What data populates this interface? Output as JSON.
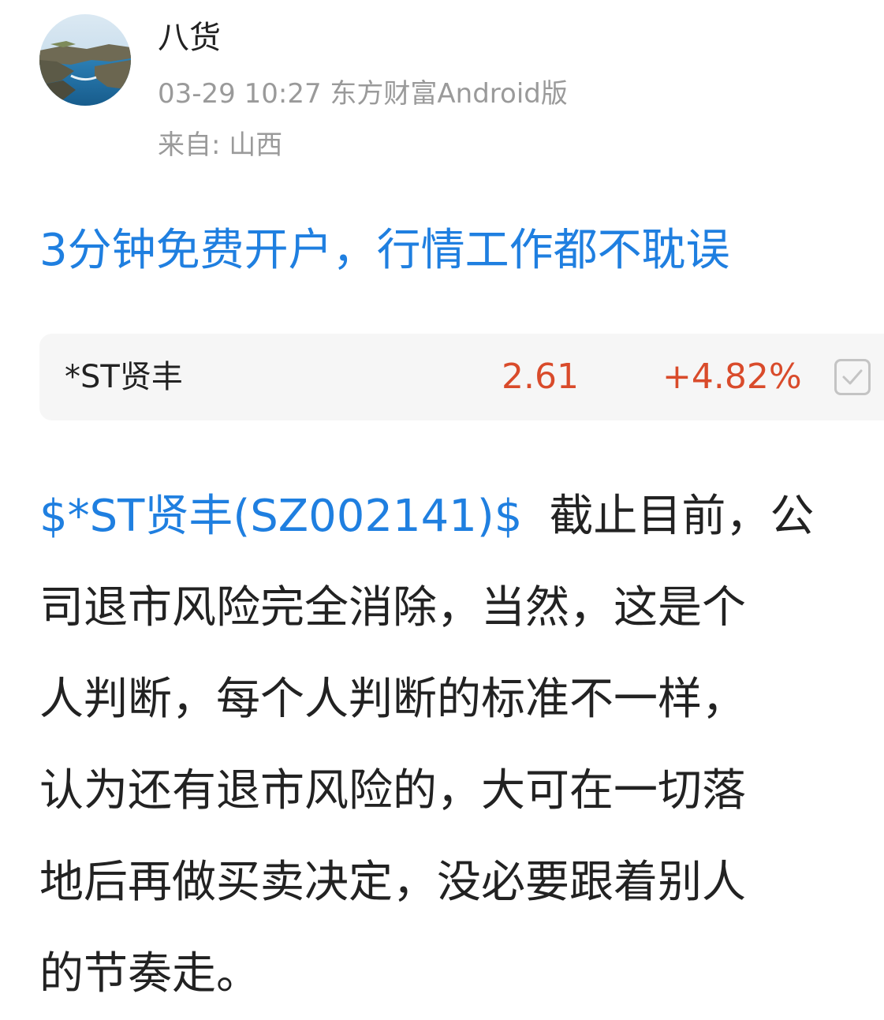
{
  "post": {
    "author": "八货",
    "meta": "03-29 10:27 东方财富Android版",
    "location": "来自: 山西",
    "promo_link": "3分钟免费开户，行情工作都不耽误",
    "stock_card": {
      "name": "*ST贤丰",
      "price": "2.61",
      "change": "+4.82%",
      "watch_icon": "checkbox-icon"
    },
    "body": {
      "stock_tag": "$*ST贤丰(SZ002141)$",
      "first_line_text": "截止目前，公",
      "lines": [
        "司退市风险完全消除，当然，这是个",
        "人判断，每个人判断的标准不一样，",
        "认为还有退市风险的，大可在一切落",
        "地后再做买卖决定，没必要跟着别人",
        "的节奏走。"
      ]
    }
  },
  "colors": {
    "link_blue": "#1f7fe0",
    "price_red": "#d94b2b",
    "meta_gray": "#9a9a9a",
    "text_dark": "#222222",
    "card_bg": "#f6f6f6"
  }
}
